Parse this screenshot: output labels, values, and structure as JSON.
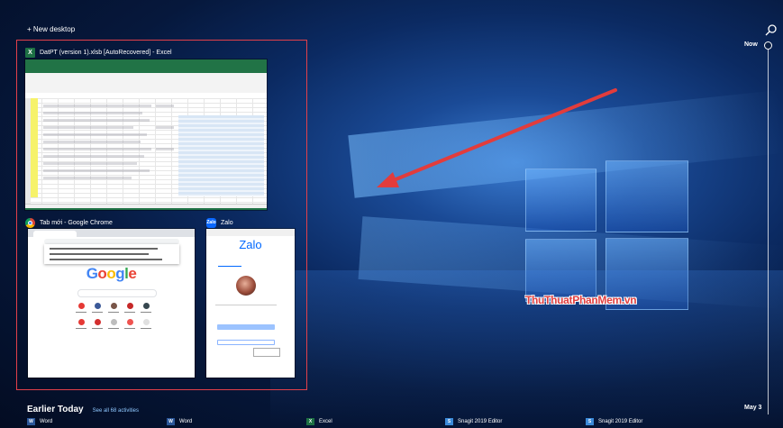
{
  "toolbar": {
    "new_desktop": "+ New desktop"
  },
  "icons": {
    "search": "search-icon",
    "timeline_node": "circle-icon"
  },
  "colors": {
    "selection": "#e2404a",
    "arrow": "#e23c3c",
    "excel": "#1d7044",
    "word": "#2b579a",
    "snagit": "#3b8ad9",
    "link": "#8fc8ff"
  },
  "timeline": {
    "now_label": "Now",
    "date_label": "May 3"
  },
  "windows": {
    "excel": {
      "title": "DatPT (version 1).xlsb [AutoRecovered] - Excel",
      "badge": "X"
    },
    "chrome": {
      "title": "Tab mới - Google Chrome",
      "google_letters": [
        "G",
        "o",
        "o",
        "g",
        "l",
        "e"
      ]
    },
    "zalo": {
      "title": "Zalo",
      "badge": "Zalo",
      "logo": "Zalo"
    }
  },
  "watermark": "ThuThuatPhanMem.vn",
  "earlier": {
    "heading": "Earlier Today",
    "see_all": "See all 68 activities",
    "activities": [
      {
        "label": "Word",
        "badge": "W",
        "type": "word"
      },
      {
        "label": "Word",
        "badge": "W",
        "type": "word"
      },
      {
        "label": "Excel",
        "badge": "X",
        "type": "excel"
      },
      {
        "label": "Snagit 2019 Editor",
        "badge": "S",
        "type": "snag"
      },
      {
        "label": "Snagit 2019 Editor",
        "badge": "S",
        "type": "snag"
      }
    ]
  }
}
